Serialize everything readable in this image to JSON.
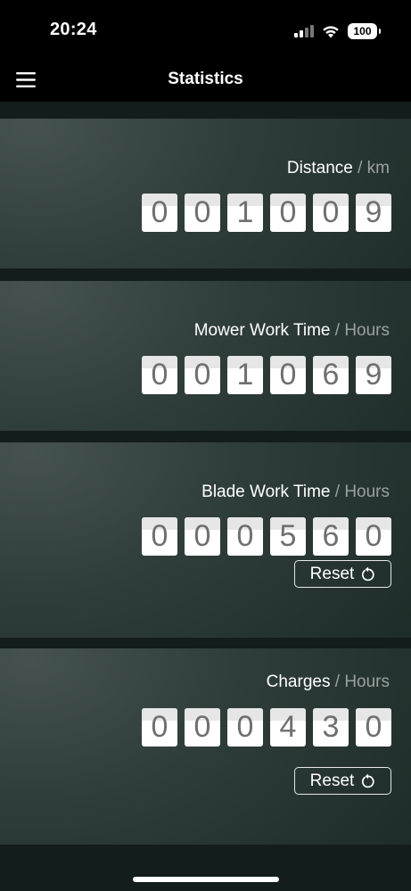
{
  "status_bar": {
    "time": "20:24",
    "battery": "100"
  },
  "nav": {
    "title": "Statistics"
  },
  "stats": [
    {
      "label": "Distance",
      "separator": " / ",
      "unit": "km",
      "digits": [
        "0",
        "0",
        "1",
        "0",
        "0",
        "9"
      ],
      "reset_label": ""
    },
    {
      "label": "Mower Work Time",
      "separator": " / ",
      "unit": "Hours",
      "digits": [
        "0",
        "0",
        "1",
        "0",
        "6",
        "9"
      ],
      "reset_label": ""
    },
    {
      "label": "Blade Work Time",
      "separator": " / ",
      "unit": "Hours",
      "digits": [
        "0",
        "0",
        "0",
        "5",
        "6",
        "0"
      ],
      "reset_label": "Reset"
    },
    {
      "label": "Charges",
      "separator": " / ",
      "unit": "Hours",
      "digits": [
        "0",
        "0",
        "0",
        "4",
        "3",
        "0"
      ],
      "reset_label": "Reset"
    }
  ]
}
